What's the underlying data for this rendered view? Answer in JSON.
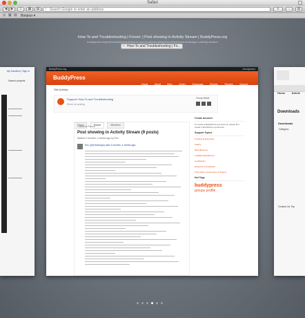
{
  "window": {
    "title": "Safari"
  },
  "toolbar": {
    "back": "◀",
    "forward": "▶",
    "address_placeholder": "Search Google or enter an address",
    "search_glyph": "⌕"
  },
  "bookmarks": {
    "label": "Bonjour ▾"
  },
  "tab_view": {
    "page_title": "How-To and Troubleshooting | Forum: | Post showing in Activity Stream | BuddyPress.org",
    "page_subtitle": "buddypress.org/community/groups/how-to-and-troubleshooting/forum/topic/post-showing-in-activity-stream/",
    "active_tab_label": "How-To and Troubleshooting | Fo...",
    "dots_count": 6,
    "active_dot_index": 3
  },
  "left_thumb": {
    "top_links": "My Sandbox | Sign in",
    "search_label": "Search projects"
  },
  "right_thumb": {
    "nav_items": [
      "Home",
      "Article"
    ],
    "heading": "Downloads",
    "subheading": "Downloads",
    "category_label": "Category",
    "footer_links": "Contact Us   Top"
  },
  "buddypress": {
    "topbar_left": "BuddyPress.org",
    "topbar_right": "Anonymous",
    "logo": "BuddyPress",
    "nav": [
      "Home",
      "About",
      "Blog",
      "Codex",
      "Showcase",
      "Plugins",
      "Themes",
      "Support",
      "Download"
    ],
    "breadcrumb": "Site Activity",
    "group_title": "Support: How-To and Troubleshooting",
    "group_sub": "Show no posting",
    "group_mods": "Group Mods",
    "tabs": [
      "Home",
      "Forum",
      "Members"
    ],
    "back_link": "« Back to Forum",
    "topic_title": "Post showing in Activity Stream (9 posts)",
    "topic_meta": "Started 4 months, 4 weeks ago by Eric",
    "post_head": "Eric (@ericdesign) said 4 months, 4 weeks ago:",
    "sidebar": {
      "create_account": "Create Account",
      "create_text": "To create a BuddyPress.org account, please first create a WordPress.org account",
      "support_topics": "Support Topics",
      "links": [
        "Creating & Extending",
        "Gallery",
        "Miscellaneous",
        "Installing BuddyPress",
        "Localization",
        "Requests & Feedback",
        "Third Party Components & Plugins"
      ],
      "tags": "Hot Tags",
      "ad_big": "buddypress",
      "ad_med": "groups profile"
    }
  }
}
